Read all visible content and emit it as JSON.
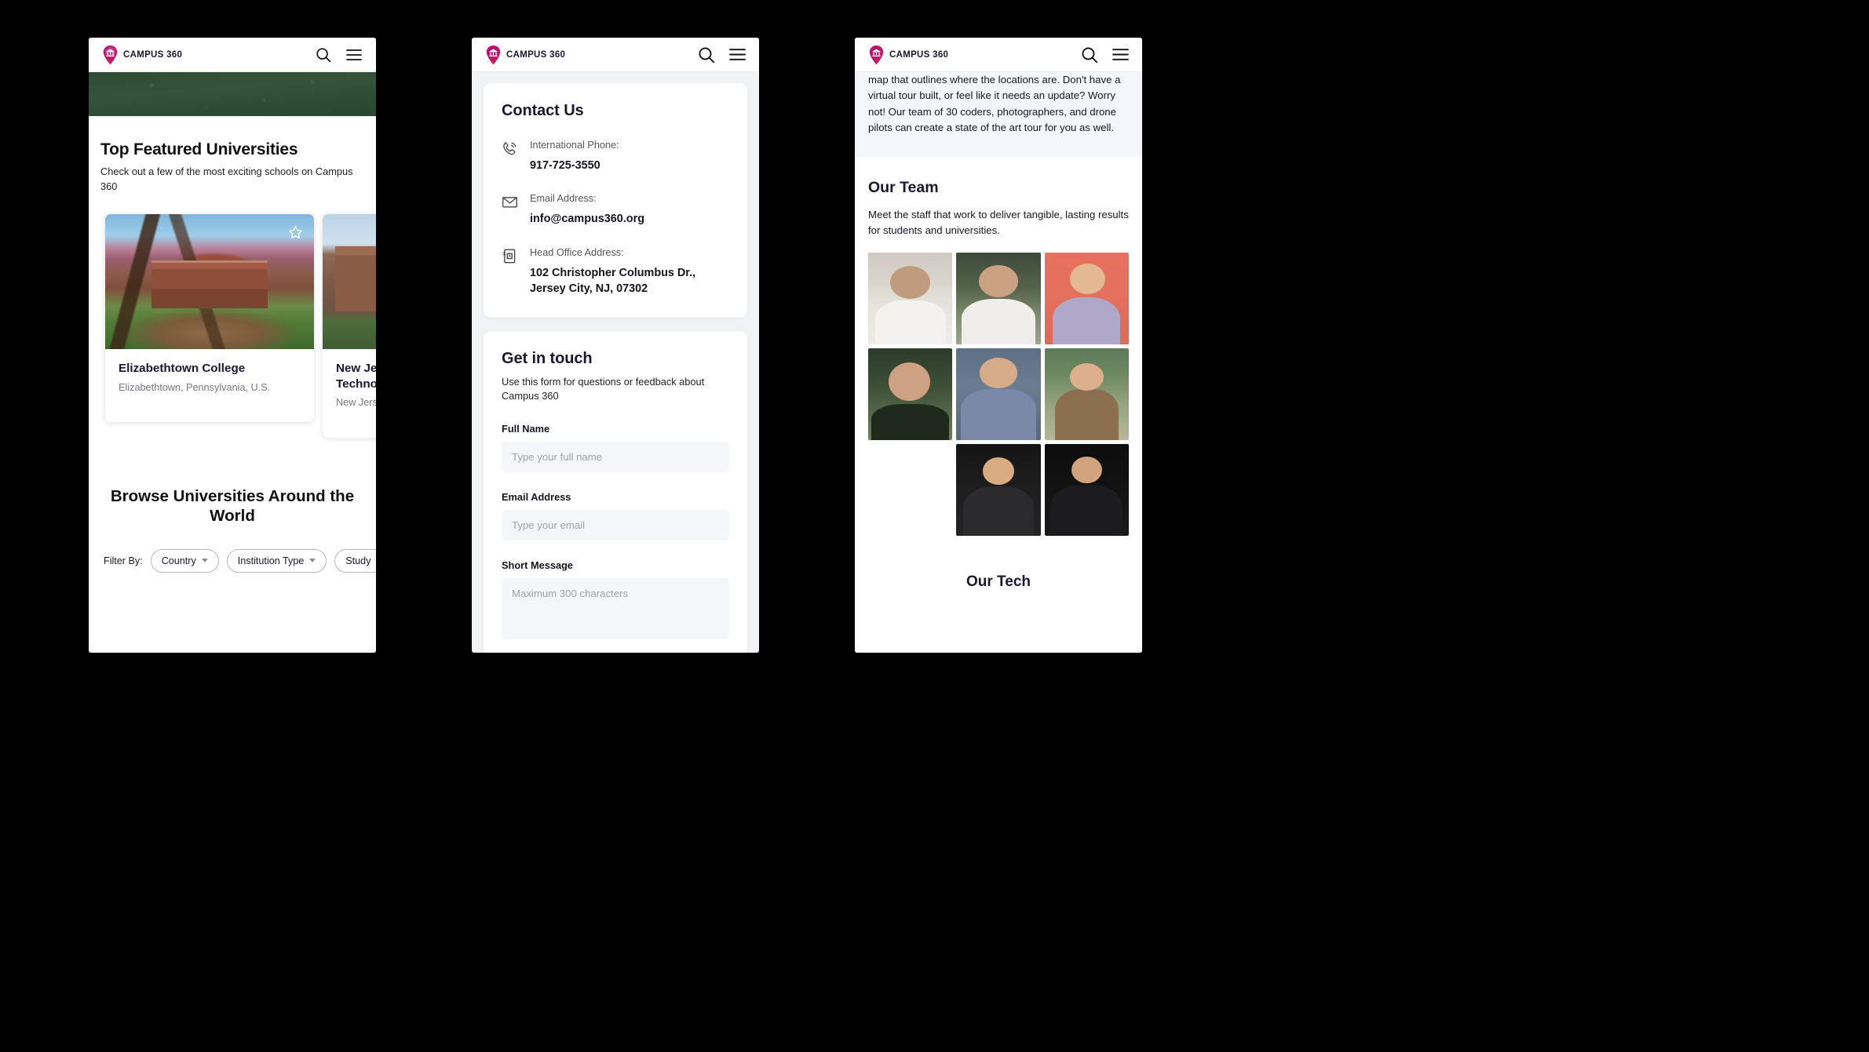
{
  "brand": {
    "name": "CAMPUS 360",
    "logo_icon": "location-pin-bank-icon",
    "color": "#c2187c"
  },
  "header": {
    "search_icon": "search-icon",
    "menu_icon": "hamburger-menu-icon"
  },
  "phone1": {
    "featured": {
      "title": "Top Featured Universities",
      "subtitle": "Check out a few of the most exciting schools on Campus 360"
    },
    "cards": [
      {
        "name": "Elizabethtown College",
        "location": "Elizabethtown, Pennsylvania, U.S.",
        "favorite_icon": "star-outline-icon"
      },
      {
        "name": "New Jersey Institute of Technology",
        "location": "New Jersey, U.S.",
        "favorite_icon": "star-outline-icon"
      }
    ],
    "browse": {
      "title": "Browse Universities Around the World",
      "filter_label": "Filter By:",
      "chips": [
        {
          "label": "Country"
        },
        {
          "label": "Institution Type"
        },
        {
          "label": "Study"
        }
      ]
    }
  },
  "phone2": {
    "contact": {
      "title": "Contact Us",
      "items": [
        {
          "icon": "phone-icon",
          "label": "International Phone:",
          "value": "917-725-3550"
        },
        {
          "icon": "envelope-icon",
          "label": "Email Address:",
          "value": "info@campus360.org"
        },
        {
          "icon": "address-book-icon",
          "label": "Head Office Address:",
          "value": "102 Christopher Columbus Dr., Jersey City, NJ, 07302"
        }
      ]
    },
    "form": {
      "title": "Get in touch",
      "subtitle": "Use this form for questions or feedback about Campus 360",
      "fields": [
        {
          "label": "Full Name",
          "placeholder": "Type your full name",
          "value": ""
        },
        {
          "label": "Email Address",
          "placeholder": "Type your email",
          "value": ""
        },
        {
          "label": "Short Message",
          "placeholder": "Maximum 300 characters",
          "value": ""
        }
      ]
    }
  },
  "phone3": {
    "blurb": "map that outlines where the locations are. Don't have a virtual tour built, or feel like it needs an update? Worry not! Our team of 30 coders, photographers, and drone pilots can create a state of the art tour for you as well.",
    "team": {
      "title": "Our Team",
      "description": "Meet the staff that work to deliver tangible, lasting results for students and universities.",
      "members": [
        {
          "name": "team-member-1"
        },
        {
          "name": "team-member-2"
        },
        {
          "name": "team-member-3"
        },
        {
          "name": "team-member-4"
        },
        {
          "name": "team-member-5"
        },
        {
          "name": "team-member-6"
        },
        {
          "name": "team-member-7"
        },
        {
          "name": "team-member-8"
        }
      ]
    },
    "tech": {
      "title": "Our Tech"
    }
  }
}
